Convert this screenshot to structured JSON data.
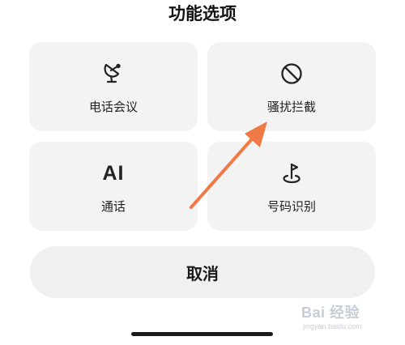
{
  "sheet": {
    "title": "功能选项",
    "options": [
      {
        "label": "电话会议",
        "icon": "satellite-dish-icon"
      },
      {
        "label": "骚扰拦截",
        "icon": "block-icon"
      },
      {
        "label": "通话",
        "icon": "ai-icon",
        "icon_text": "AI"
      },
      {
        "label": "号码识别",
        "icon": "location-flag-icon"
      }
    ],
    "cancel_label": "取消"
  },
  "annotation": {
    "arrow_color": "#f07a45"
  },
  "watermark": {
    "brand": "Bai 经验",
    "url": "jingyan.baidu.com"
  }
}
